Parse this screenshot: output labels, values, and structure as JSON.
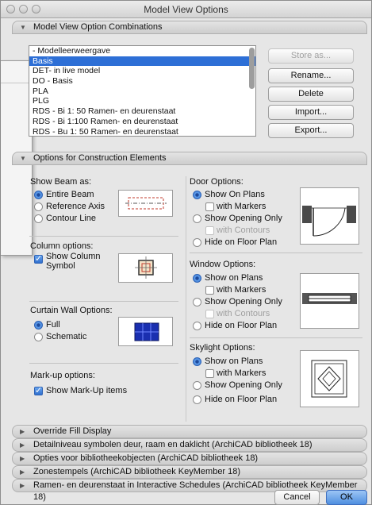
{
  "window": {
    "title": "Model View Options"
  },
  "sections": {
    "combinations": {
      "label": "Model View Option Combinations"
    },
    "construction": {
      "label": "Options for Construction Elements"
    },
    "collapsed": [
      "Override Fill Display",
      "Detailniveau symbolen deur, raam en daklicht (ArchiCAD bibliotheek 18)",
      "Opties voor bibliotheekobjecten (ArchiCAD bibliotheek 18)",
      "Zonestempels (ArchiCAD bibliotheek KeyMember 18)",
      "Ramen- en deurenstaat in Interactive Schedules (ArchiCAD bibliotheek KeyMember 18)"
    ]
  },
  "list": {
    "items": [
      "- Modelleerweergave",
      "Basis",
      "DET- in live model",
      "DO - Basis",
      "PLA",
      "PLG",
      "RDS - Bi 1: 50 Ramen- en deurenstaat",
      "RDS - Bi 1:100 Ramen- en deurenstaat",
      "RDS - Bu 1: 50 Ramen- en deurenstaat"
    ],
    "selected_index": 1
  },
  "buttons": {
    "store_as": "Store as...",
    "rename": "Rename...",
    "delete": "Delete",
    "import": "Import...",
    "export": "Export...",
    "cancel": "Cancel",
    "ok": "OK"
  },
  "beam": {
    "title": "Show Beam as:",
    "options": [
      "Entire Beam",
      "Reference Axis",
      "Contour Line"
    ],
    "selected": 0
  },
  "column": {
    "title": "Column options:",
    "show_symbol_line1": "Show Column",
    "show_symbol_line2": "Symbol",
    "checked": true
  },
  "curtain": {
    "title": "Curtain Wall Options:",
    "options": [
      "Full",
      "Schematic"
    ],
    "selected": 0
  },
  "markup": {
    "title": "Mark-up options:",
    "show_label": "Show Mark-Up items",
    "checked": true
  },
  "door": {
    "title": "Door Options:",
    "show_on_plans": "Show On Plans",
    "with_markers": "with Markers",
    "show_opening_only": "Show Opening Only",
    "with_contours": "with Contours",
    "hide": "Hide on Floor Plan",
    "selected": "show_on_plans"
  },
  "window_opts": {
    "title": "Window Options:",
    "show_on_plans": "Show on Plans",
    "with_markers": "with Markers",
    "show_opening_only": "Show Opening Only",
    "with_contours": "with Contours",
    "hide": "Hide on Floor Plan",
    "selected": "show_on_plans"
  },
  "skylight": {
    "title": "Skylight Options:",
    "show_on_plans": "Show on Plans",
    "with_markers": "with Markers",
    "show_opening_only": "Show Opening Only",
    "hide": "Hide on Floor Plan",
    "selected": "show_on_plans"
  },
  "colors": {
    "selection": "#2d6fd6",
    "accent": "#3a7bd5"
  }
}
